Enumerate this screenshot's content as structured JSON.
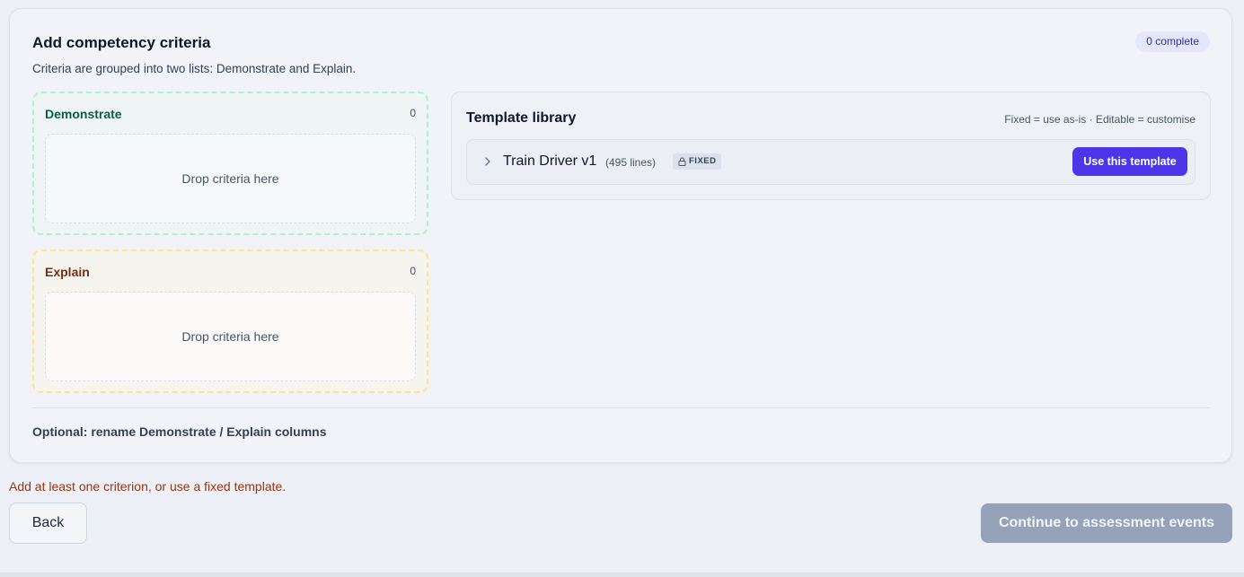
{
  "card": {
    "title": "Add competency criteria",
    "subtitle": "Criteria are grouped into two lists: Demonstrate and Explain.",
    "badge": "0 complete"
  },
  "groups": [
    {
      "title": "Demonstrate",
      "count": "0",
      "dropzone": "Drop criteria here"
    },
    {
      "title": "Explain",
      "count": "0",
      "dropzone": "Drop criteria here"
    }
  ],
  "library": {
    "title": "Template library",
    "hint": "Fixed = use as-is · Editable = customise",
    "templates": [
      {
        "name": "Train Driver v1",
        "lines": "(495 lines)",
        "tag": "FIXED",
        "button": "Use this template"
      }
    ]
  },
  "rename_link": "Optional: rename Demonstrate / Explain columns",
  "warning": "Add at least one criterion, or use a fixed template.",
  "footer": {
    "back": "Back",
    "continue": "Continue to assessment events"
  },
  "colors": {
    "accent": "#4f35e8",
    "demonstrate": "#065f46",
    "explain": "#7c2d12",
    "warning": "#9a3412",
    "disabled": "#94a3b8"
  }
}
